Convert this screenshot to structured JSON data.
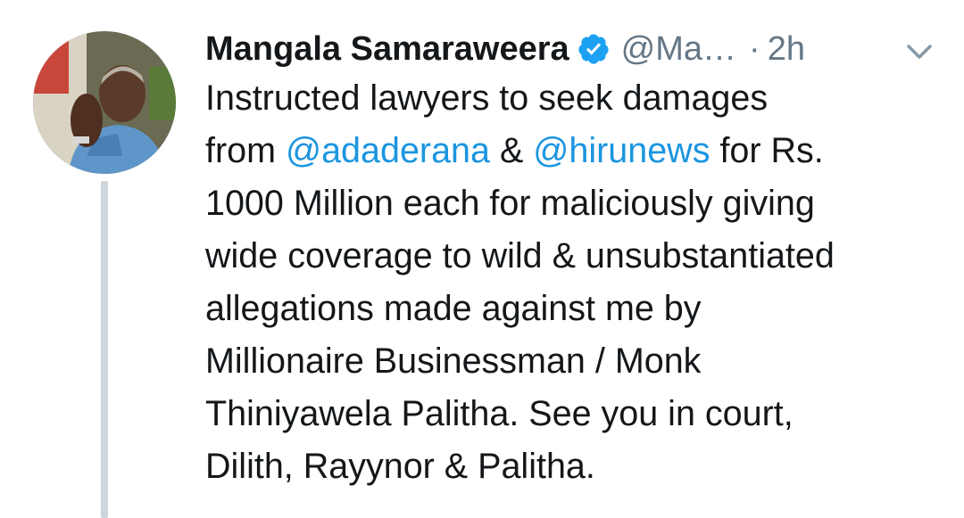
{
  "tweet": {
    "author_name": "Mangala Samaraweera",
    "handle": "@Ma…",
    "separator": "·",
    "time": "2h",
    "verified": true,
    "avatar_icon": "user-avatar-photo",
    "menu_icon": "chevron-down-icon",
    "lines": [
      {
        "parts": [
          {
            "text": "Instructed lawyers to seek damages",
            "type": "text"
          }
        ]
      },
      {
        "parts": [
          {
            "text": "from ",
            "type": "text"
          },
          {
            "text": "@adaderana",
            "type": "mention"
          },
          {
            "text": " & ",
            "type": "text"
          },
          {
            "text": "@hirunews",
            "type": "mention"
          },
          {
            "text": " for Rs.",
            "type": "text"
          }
        ]
      },
      {
        "parts": [
          {
            "text": "1000 Million each for maliciously giving",
            "type": "text"
          }
        ]
      },
      {
        "parts": [
          {
            "text": "wide coverage to wild & unsubstantiated",
            "type": "text"
          }
        ]
      },
      {
        "parts": [
          {
            "text": "allegations made against me by",
            "type": "text"
          }
        ]
      },
      {
        "parts": [
          {
            "text": "Millionaire Businessman / Monk",
            "type": "text"
          }
        ]
      },
      {
        "parts": [
          {
            "text": "Thiniyawela Palitha. See you in court,",
            "type": "text"
          }
        ]
      },
      {
        "parts": [
          {
            "text": "Dilith, Rayynor & Palitha.",
            "type": "text"
          }
        ]
      }
    ]
  },
  "colors": {
    "text": "#14171a",
    "secondary": "#657786",
    "mention": "#1b95e0",
    "verified_badge": "#1da1f2",
    "thread_line": "#ccd6dd"
  }
}
